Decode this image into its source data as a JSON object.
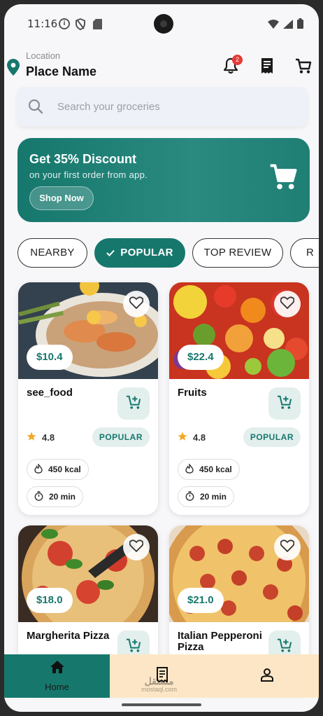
{
  "status_bar": {
    "time": "11:16"
  },
  "header": {
    "location_label": "Location",
    "location_name": "Place Name",
    "notification_count": "2"
  },
  "search": {
    "placeholder": "Search your groceries"
  },
  "promo": {
    "title": "Get 35% Discount",
    "subtitle": "on your first order from app.",
    "button_label": "Shop Now"
  },
  "filters": [
    {
      "label": "NEARBY",
      "active": false
    },
    {
      "label": "POPULAR",
      "active": true
    },
    {
      "label": "TOP REVIEW",
      "active": false
    },
    {
      "label": "R",
      "active": false
    }
  ],
  "products": [
    {
      "name": "see_food",
      "price": "$10.4",
      "rating": "4.8",
      "tag": "POPULAR",
      "calories": "450 kcal",
      "time": "20 min"
    },
    {
      "name": "Fruits",
      "price": "$22.4",
      "rating": "4.8",
      "tag": "POPULAR",
      "calories": "450 kcal",
      "time": "20 min"
    },
    {
      "name": "Margherita Pizza",
      "price": "$18.0"
    },
    {
      "name": "Italian Pepperoni Pizza",
      "price": "$21.0"
    }
  ],
  "bottom_nav": {
    "home_label": "Home"
  },
  "watermark": {
    "line1": "مستقل",
    "line2": "mostaql.com"
  },
  "colors": {
    "primary": "#16786d",
    "nav_background": "#fde6c6",
    "badge": "#e53935",
    "star": "#f5a623"
  }
}
